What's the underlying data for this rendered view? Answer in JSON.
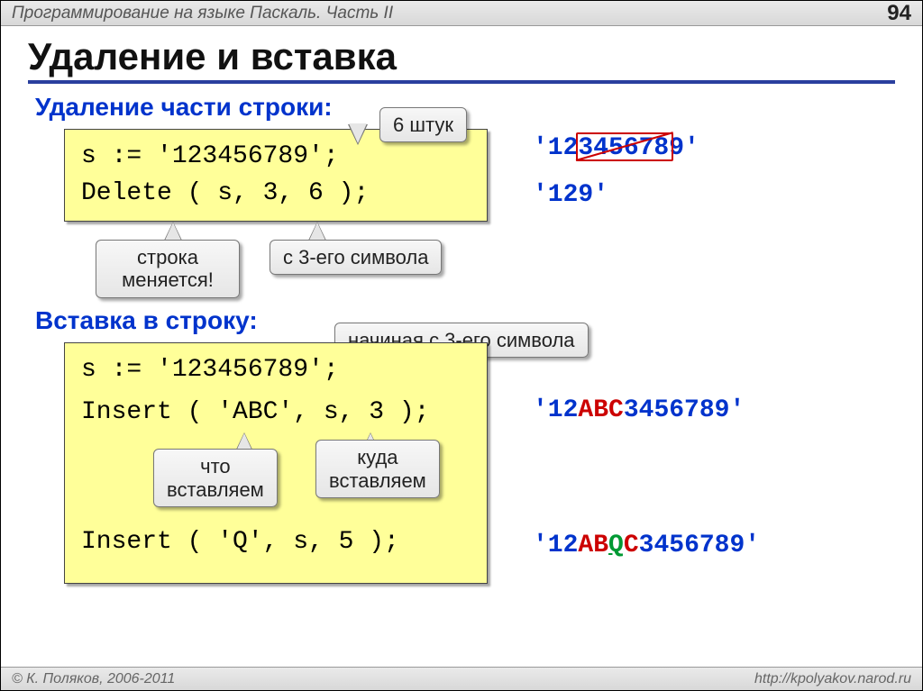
{
  "header": {
    "title": "Программирование на языке Паскаль. Часть II",
    "page": "94"
  },
  "title": "Удаление и вставка",
  "delete": {
    "heading": "Удаление части строки:",
    "code_line1": "s := '123456789';",
    "code_line2": "Delete ( s, 3, 6 );",
    "callout_count": "6 штук",
    "callout_changes": "строка\nменяется!",
    "callout_from": "с 3-его символа",
    "out_before_q1": "'12",
    "out_before_mid": "345678",
    "out_before_q2": "9'",
    "out_after": "'129'"
  },
  "insert": {
    "heading": "Вставка в строку:",
    "code_line1": "s := '123456789';",
    "code_line2": "Insert ( 'ABC', s, 3 );",
    "code_line3": "Insert ( 'Q', s, 5 );",
    "callout_start": "начиная с 3-его символа",
    "callout_what": "что\nвставляем",
    "callout_where": "куда\nвставляем",
    "out1_a": "'12",
    "out1_b": "ABC",
    "out1_c": "3456789'",
    "out2_a": "'12",
    "out2_b": "AB",
    "out2_c": "Q",
    "out2_d": "C",
    "out2_e": "3456789'"
  },
  "footer": {
    "left": "© К. Поляков, 2006-2011",
    "right": "http://kpolyakov.narod.ru"
  }
}
